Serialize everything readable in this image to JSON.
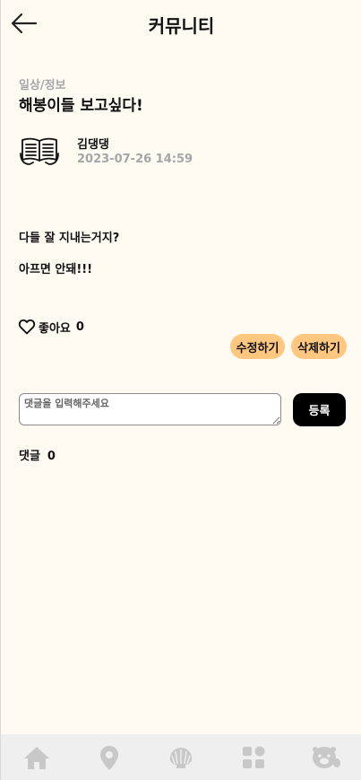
{
  "header": {
    "title": "커뮤니티",
    "back_icon": "arrow-left-icon"
  },
  "post": {
    "category": "일상/정보",
    "title": "해봉이들 보고싶다!",
    "author": {
      "name": "김댕댕",
      "avatar_icon": "open-book-icon"
    },
    "date": "2023-07-26 14:59",
    "content": [
      "다들 잘 지내는거지?",
      "아프면 안돼!!!"
    ]
  },
  "like": {
    "label": "좋아요",
    "count": "0",
    "icon": "heart-outline-icon"
  },
  "actions": {
    "edit_label": "수정하기",
    "delete_label": "삭제하기",
    "color": "#ffc77f"
  },
  "comment_form": {
    "placeholder": "댓글을 입력해주세요",
    "value": "",
    "submit_label": "등록"
  },
  "comments": {
    "label": "댓글",
    "count": "0"
  },
  "bottom_nav": {
    "items": [
      {
        "icon": "home-icon"
      },
      {
        "icon": "map-pin-icon"
      },
      {
        "icon": "shell-icon"
      },
      {
        "icon": "grid-icon"
      },
      {
        "icon": "otter-icon"
      }
    ],
    "icon_color": "#c8c8c8"
  }
}
